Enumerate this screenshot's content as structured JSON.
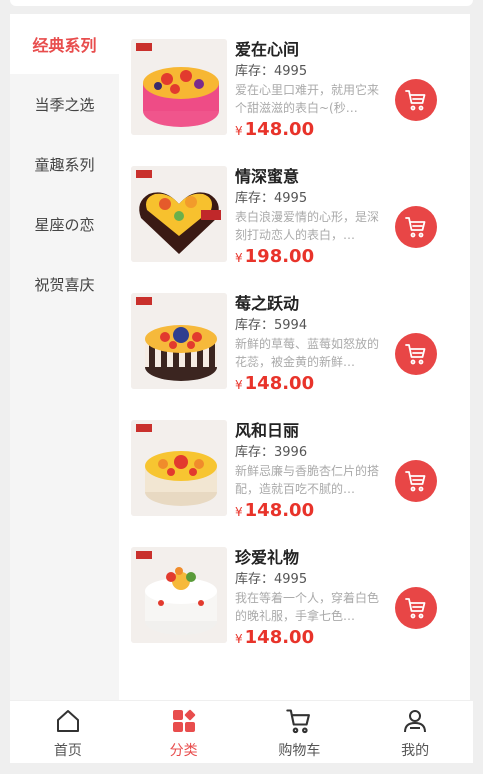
{
  "sidebar": {
    "items": [
      {
        "label": "经典系列",
        "active": true
      },
      {
        "label": "当季之选",
        "active": false
      },
      {
        "label": "童趣系列",
        "active": false
      },
      {
        "label": "星座の恋",
        "active": false
      },
      {
        "label": "祝贺喜庆",
        "active": false
      }
    ]
  },
  "products": [
    {
      "name": "爱在心间",
      "stock": "库存：4995",
      "desc": "爱在心里口难开，就用它来个甜滋滋的表白~(秒…",
      "currency": "¥",
      "price": "148.00"
    },
    {
      "name": "情深蜜意",
      "stock": "库存：4995",
      "desc": "表白浪漫爱情的心形，是深刻打动恋人的表白，…",
      "currency": "¥",
      "price": "198.00"
    },
    {
      "name": "莓之跃动",
      "stock": "库存：5994",
      "desc": "新鲜的草莓、蓝莓如怒放的花蕊，被金黄的新鲜…",
      "currency": "¥",
      "price": "148.00"
    },
    {
      "name": "风和日丽",
      "stock": "库存：3996",
      "desc": "新鲜忌廉与香脆杏仁片的搭配，造就百吃不腻的…",
      "currency": "¥",
      "price": "148.00"
    },
    {
      "name": "珍爱礼物",
      "stock": "库存：4995",
      "desc": "我在等着一个人，穿着白色的晚礼服，手拿七色…",
      "currency": "¥",
      "price": "148.00"
    }
  ],
  "tabbar": {
    "items": [
      {
        "label": "首页",
        "icon": "home-icon",
        "active": false
      },
      {
        "label": "分类",
        "icon": "category-icon",
        "active": true
      },
      {
        "label": "购物车",
        "icon": "shopping-cart-icon",
        "active": false
      },
      {
        "label": "我的",
        "icon": "user-icon",
        "active": false
      }
    ]
  },
  "colors": {
    "accent": "#e84d4d",
    "price": "#e8332a",
    "cart_button": "#e84646"
  }
}
